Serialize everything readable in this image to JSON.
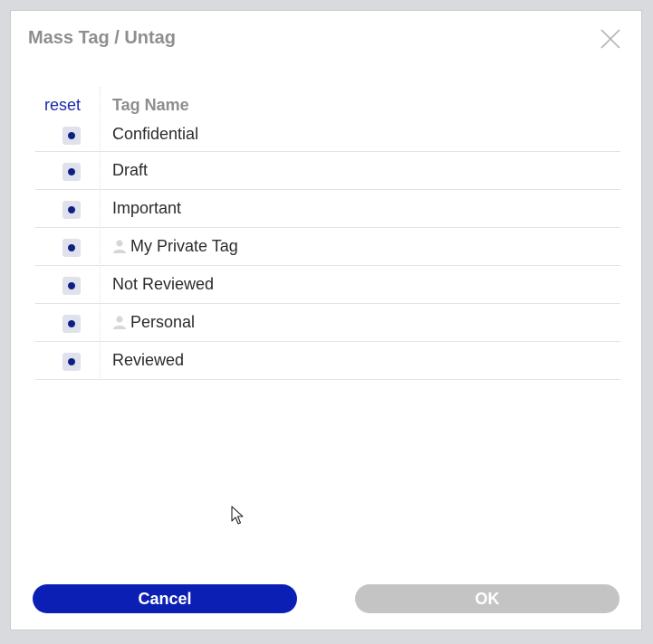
{
  "dialog": {
    "title": "Mass Tag / Untag",
    "close_icon": "close-icon"
  },
  "table": {
    "reset_label": "reset",
    "header_name": "Tag Name",
    "rows": [
      {
        "label": "Confidential",
        "private": false,
        "state": "mixed"
      },
      {
        "label": "Draft",
        "private": false,
        "state": "mixed"
      },
      {
        "label": "Important",
        "private": false,
        "state": "mixed"
      },
      {
        "label": "My Private Tag",
        "private": true,
        "state": "mixed"
      },
      {
        "label": "Not Reviewed",
        "private": false,
        "state": "mixed"
      },
      {
        "label": "Personal",
        "private": true,
        "state": "mixed"
      },
      {
        "label": "Reviewed",
        "private": false,
        "state": "mixed"
      }
    ]
  },
  "buttons": {
    "cancel_label": "Cancel",
    "ok_label": "OK"
  },
  "colors": {
    "accent": "#0c1fb4",
    "disabled": "#c4c4c4",
    "checkbox_dot": "#0f1f86"
  }
}
